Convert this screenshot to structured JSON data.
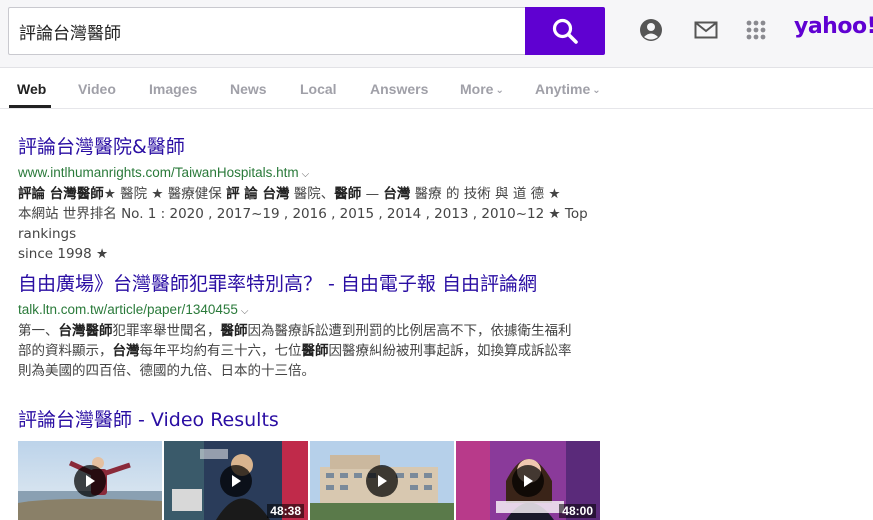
{
  "search": {
    "query": "評論台灣醫師"
  },
  "header": {
    "logo_text": "yahoo!",
    "icons": [
      "search-icon",
      "account-icon",
      "mail-icon",
      "apps-icon"
    ]
  },
  "tabs": [
    {
      "label": "Web",
      "active": true
    },
    {
      "label": "Video"
    },
    {
      "label": "Images"
    },
    {
      "label": "News"
    },
    {
      "label": "Local"
    },
    {
      "label": "Answers"
    },
    {
      "label": "More"
    },
    {
      "label": "Anytime"
    }
  ],
  "results": [
    {
      "title": "評論台灣醫院&醫師",
      "url": "www.intlhumanrights.com/TaiwanHospitals.htm",
      "snippet_line1_bold1": "評論 台灣醫師",
      "snippet_line1_rest1": "★ 醫院 ★ 醫療健保 ",
      "snippet_line1_bold2": "評 論 台灣",
      "snippet_line1_rest2": " 醫院、",
      "snippet_line1_bold3": "醫師",
      "snippet_line1_rest3": " — ",
      "snippet_line1_bold4": "台灣",
      "snippet_line1_rest4": " 醫療 的 技術 與 道 德 ★",
      "snippet_line2": "本網站 世界排名 No. 1 : 2020 , 2017~19 , 2016 , 2015 , 2014 , 2013 , 2010~12 ★ Top rankings",
      "snippet_line3": "since 1998 ★"
    },
    {
      "title": "自由廣場》台灣醫師犯罪率特別高？ - 自由電子報 自由評論網",
      "url": "talk.ltn.com.tw/article/paper/1340455",
      "s_a": "第一、",
      "s_b": "台灣醫師",
      "s_c": "犯罪率舉世聞名，",
      "s_d": "醫師",
      "s_e": "因為醫療訴訟遭到刑罰的比例居高不下，依據衛生福利",
      "s_f": "部的資料顯示，",
      "s_g": "台灣",
      "s_h": "每年平均約有三十六，七位",
      "s_i": "醫師",
      "s_j": "因醫療糾紛被刑事起訴，如換算成訴訟率",
      "s_k": "則為美國的四百倍、德國的九倍、日本的十三倍。"
    }
  ],
  "video_results": {
    "title": "評論台灣醫師 - Video Results",
    "thumbnails": [
      {
        "duration": ""
      },
      {
        "duration": "48:38"
      },
      {
        "duration": ""
      },
      {
        "duration": "48:00"
      }
    ]
  },
  "colors": {
    "brand": "#6001d2",
    "search_button": "#5f01d1",
    "link": "#2a0ea3",
    "url": "#2a7a3a"
  }
}
